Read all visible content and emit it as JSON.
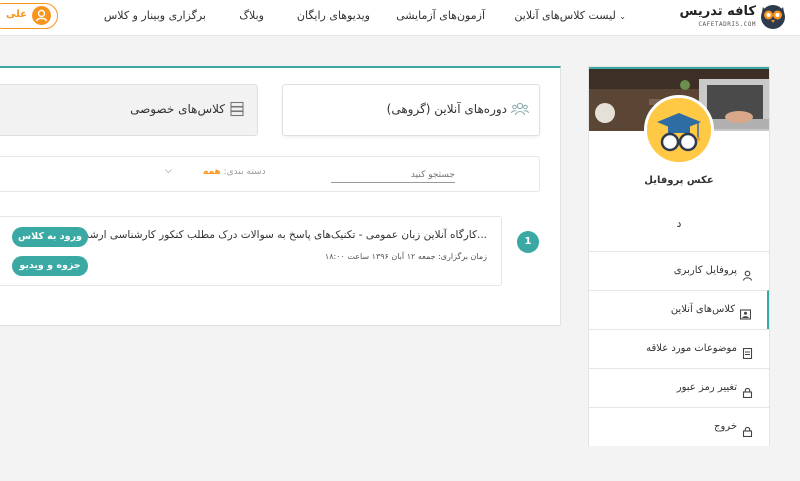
{
  "header": {
    "logo_text": "کافه تدریس",
    "logo_subtitle": "CAFETADRIS.COM",
    "nav": [
      {
        "label": "لیست کلاس‌های آنلاین",
        "dropdown": true
      },
      {
        "label": "آزمون‌های آزمایشی"
      },
      {
        "label": "ویدیوهای رایگان"
      },
      {
        "label": "وبلاگ"
      },
      {
        "label": "برگزاری وبینار و کلاس"
      }
    ],
    "user_label": "علی",
    "accent_color": "#f7941d"
  },
  "sidebar": {
    "profile_label": "عکس پروفایل",
    "profile_name": "د",
    "items": [
      {
        "label": "پروفایل کاربری",
        "icon": "user-icon",
        "active": false
      },
      {
        "label": "کلاس‌های آنلاین",
        "icon": "image-icon",
        "active": true
      },
      {
        "label": "موضوعات مورد علاقه",
        "icon": "document-icon",
        "active": false
      },
      {
        "label": "تغییر رمز عبور",
        "icon": "lock-icon",
        "active": false
      },
      {
        "label": "خروج",
        "icon": "lock-icon",
        "active": false
      }
    ]
  },
  "main": {
    "tabs": [
      {
        "label": "دوره‌های آنلاین (گروهی)",
        "icon": "users-icon"
      },
      {
        "label": "کلاس‌های خصوصی",
        "icon": "server-icon"
      }
    ],
    "filter": {
      "search_placeholder": "جستجو کنید",
      "category_label": "دسته بندی:",
      "category_value": "همه"
    },
    "courses": [
      {
        "number": "1",
        "title": "کارگاه آنلاین زبان عمومی - تکنیک‌های پاسخ به سوالات درک مطلب کنکور کارشناسی ارشد و...",
        "date": "زمان برگزاری: جمعه ۱۲ آبان ۱۳۹۶ ساعت ۱۸:۰۰",
        "enter_label": "ورود به کلاس",
        "media_label": "جزوه و ویدیو"
      }
    ]
  },
  "colors": {
    "teal": "#3aa9a4",
    "orange": "#f7941d"
  }
}
